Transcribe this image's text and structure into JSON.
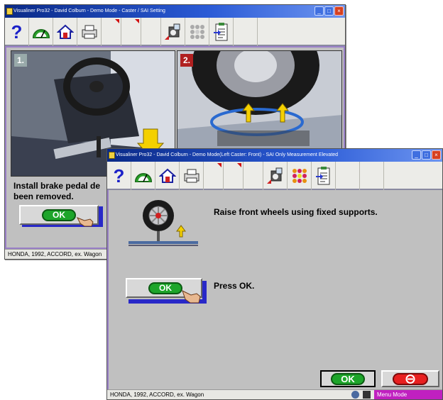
{
  "back_window": {
    "title": "Visualiner Pro32 - David Colburn - Demo Mode  -  Caster / SAI Setting",
    "panel1_number": "1.",
    "panel2_number": "2.",
    "instruction": "Install brake pedal depressor. ... been removed.",
    "instruction_line1": "Install brake pedal de",
    "instruction_line2": "been removed.",
    "ok_label": "OK",
    "status": "HONDA, 1992, ACCORD, ex. Wagon"
  },
  "front_window": {
    "title": "Visualiner Pro32 - David Colburn - Demo Mode(Left Caster: Front)  -  SAI Only Measurement Elevated",
    "help_label": "?",
    "raise_text": "Raise front wheels using fixed supports.",
    "press_text": "Press OK.",
    "ok_label": "OK",
    "ok_bottom_label": "OK",
    "status": "HONDA, 1992, ACCORD, ex. Wagon",
    "mode": "Menu Mode"
  },
  "colors": {
    "title_start": "#0a2a88",
    "ok_green": "#1da52a",
    "cancel_red": "#e82020",
    "menu_mode_bg": "#c020c0"
  },
  "icons": [
    "help-icon",
    "gauge-icon",
    "home-icon",
    "printer-icon",
    "camera-target-icon",
    "dots-pattern-icon",
    "clipboard-arrow-icon",
    "hand-pointer-icon",
    "no-entry-icon",
    "wheel-on-stand-icon"
  ]
}
